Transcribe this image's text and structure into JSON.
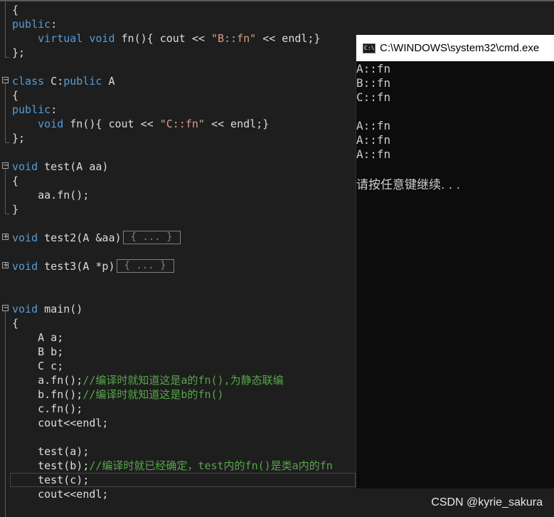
{
  "editor": {
    "lines": [
      {
        "id": "l0",
        "parts": [
          {
            "c": "p",
            "t": "{"
          }
        ]
      },
      {
        "id": "l1",
        "parts": [
          {
            "c": "kw",
            "t": "public"
          },
          {
            "c": "p",
            "t": ":"
          }
        ]
      },
      {
        "id": "l2",
        "parts": [
          {
            "c": "p",
            "t": "    "
          },
          {
            "c": "kw",
            "t": "virtual"
          },
          {
            "c": "p",
            "t": " "
          },
          {
            "c": "kw",
            "t": "void"
          },
          {
            "c": "p",
            "t": " fn(){ cout << "
          },
          {
            "c": "str",
            "t": "\"B::fn\""
          },
          {
            "c": "p",
            "t": " << endl;}"
          }
        ]
      },
      {
        "id": "l3",
        "parts": [
          {
            "c": "p",
            "t": "};"
          }
        ]
      },
      {
        "id": "l5",
        "parts": [
          {
            "c": "kw",
            "t": "class"
          },
          {
            "c": "p",
            "t": " C:"
          },
          {
            "c": "kw",
            "t": "public"
          },
          {
            "c": "p",
            "t": " A"
          }
        ]
      },
      {
        "id": "l6",
        "parts": [
          {
            "c": "p",
            "t": "{"
          }
        ]
      },
      {
        "id": "l7",
        "parts": [
          {
            "c": "kw",
            "t": "public"
          },
          {
            "c": "p",
            "t": ":"
          }
        ]
      },
      {
        "id": "l8",
        "parts": [
          {
            "c": "p",
            "t": "    "
          },
          {
            "c": "kw",
            "t": "void"
          },
          {
            "c": "p",
            "t": " fn(){ cout << "
          },
          {
            "c": "str",
            "t": "\"C::fn\""
          },
          {
            "c": "p",
            "t": " << endl;}"
          }
        ]
      },
      {
        "id": "l9",
        "parts": [
          {
            "c": "p",
            "t": "};"
          }
        ]
      },
      {
        "id": "l11",
        "parts": [
          {
            "c": "kw",
            "t": "void"
          },
          {
            "c": "p",
            "t": " test(A aa)"
          }
        ]
      },
      {
        "id": "l12",
        "parts": [
          {
            "c": "p",
            "t": "{"
          }
        ]
      },
      {
        "id": "l13",
        "parts": [
          {
            "c": "p",
            "t": "    aa.fn();"
          }
        ]
      },
      {
        "id": "l14",
        "parts": [
          {
            "c": "p",
            "t": "}"
          }
        ]
      },
      {
        "id": "l16",
        "parts": [
          {
            "c": "kw",
            "t": "void"
          },
          {
            "c": "p",
            "t": " test2(A &aa)"
          }
        ],
        "collapsed": "{ ... }"
      },
      {
        "id": "l18",
        "parts": [
          {
            "c": "kw",
            "t": "void"
          },
          {
            "c": "p",
            "t": " test3(A *p)"
          }
        ],
        "collapsed": "{ ... }"
      },
      {
        "id": "l21",
        "parts": [
          {
            "c": "kw",
            "t": "void"
          },
          {
            "c": "p",
            "t": " main()"
          }
        ]
      },
      {
        "id": "l22",
        "parts": [
          {
            "c": "p",
            "t": "{"
          }
        ]
      },
      {
        "id": "l23",
        "parts": [
          {
            "c": "p",
            "t": "    A a;"
          }
        ]
      },
      {
        "id": "l24",
        "parts": [
          {
            "c": "p",
            "t": "    B b;"
          }
        ]
      },
      {
        "id": "l25",
        "parts": [
          {
            "c": "p",
            "t": "    C c;"
          }
        ]
      },
      {
        "id": "l26",
        "parts": [
          {
            "c": "p",
            "t": "    a.fn();"
          },
          {
            "c": "cmt",
            "t": "//编译时就知道这是a的fn(),为静态联编"
          }
        ]
      },
      {
        "id": "l27",
        "parts": [
          {
            "c": "p",
            "t": "    b.fn();"
          },
          {
            "c": "cmt",
            "t": "//编译时就知道这是b的fn()"
          }
        ]
      },
      {
        "id": "l28",
        "parts": [
          {
            "c": "p",
            "t": "    c.fn();"
          }
        ]
      },
      {
        "id": "l29",
        "parts": [
          {
            "c": "p",
            "t": "    cout<<endl;"
          }
        ]
      },
      {
        "id": "l31",
        "parts": [
          {
            "c": "p",
            "t": "    test(a);"
          }
        ]
      },
      {
        "id": "l32",
        "parts": [
          {
            "c": "p",
            "t": "    test(b);"
          },
          {
            "c": "cmt",
            "t": "//编译时就已经确定，test内的fn()是类a内的fn"
          }
        ]
      },
      {
        "id": "l33",
        "parts": [
          {
            "c": "p",
            "t": "    test(c);"
          }
        ]
      },
      {
        "id": "l34",
        "parts": [
          {
            "c": "p",
            "t": "    cout<<endl;"
          }
        ]
      }
    ]
  },
  "console": {
    "title": "C:\\WINDOWS\\system32\\cmd.exe",
    "icon": "console-icon",
    "output": [
      "A::fn",
      "B::fn",
      "C::fn",
      "",
      "A::fn",
      "A::fn",
      "A::fn",
      ""
    ],
    "prompt": "请按任意键继续. . ."
  },
  "watermark": "CSDN @kyrie_sakura"
}
